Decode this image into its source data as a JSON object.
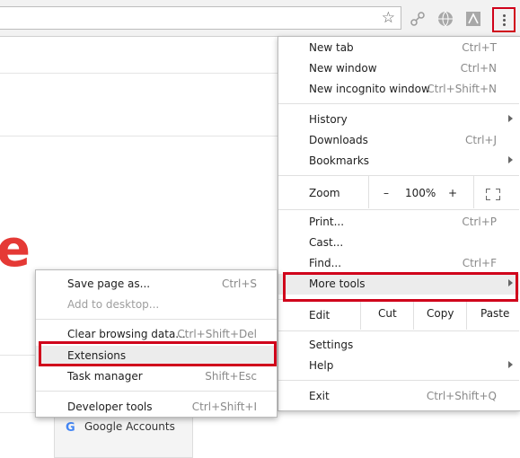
{
  "menu": {
    "new_tab": {
      "label": "New tab",
      "shortcut": "Ctrl+T"
    },
    "new_window": {
      "label": "New window",
      "shortcut": "Ctrl+N"
    },
    "new_incognito": {
      "label": "New incognito window",
      "shortcut": "Ctrl+Shift+N"
    },
    "history": {
      "label": "History"
    },
    "downloads": {
      "label": "Downloads",
      "shortcut": "Ctrl+J"
    },
    "bookmarks": {
      "label": "Bookmarks"
    },
    "zoom": {
      "label": "Zoom",
      "minus": "–",
      "value": "100%",
      "plus": "+"
    },
    "print": {
      "label": "Print...",
      "shortcut": "Ctrl+P"
    },
    "cast": {
      "label": "Cast..."
    },
    "find": {
      "label": "Find...",
      "shortcut": "Ctrl+F"
    },
    "more_tools": {
      "label": "More tools"
    },
    "edit": {
      "label": "Edit",
      "cut": "Cut",
      "copy": "Copy",
      "paste": "Paste"
    },
    "settings": {
      "label": "Settings"
    },
    "help": {
      "label": "Help"
    },
    "exit": {
      "label": "Exit",
      "shortcut": "Ctrl+Shift+Q"
    }
  },
  "submenu": {
    "save_page": {
      "label": "Save page as...",
      "shortcut": "Ctrl+S"
    },
    "add_desktop": {
      "label": "Add to desktop..."
    },
    "clear_data": {
      "label": "Clear browsing data...",
      "shortcut": "Ctrl+Shift+Del"
    },
    "extensions": {
      "label": "Extensions"
    },
    "task_manager": {
      "label": "Task manager",
      "shortcut": "Shift+Esc"
    },
    "dev_tools": {
      "label": "Developer tools",
      "shortcut": "Ctrl+Shift+I"
    }
  },
  "page": {
    "logo_letter": "e",
    "card_title": "Google Accounts",
    "card_icon": "G"
  },
  "colors": {
    "highlight_box": "#d0021b",
    "logo": "#e53935"
  }
}
